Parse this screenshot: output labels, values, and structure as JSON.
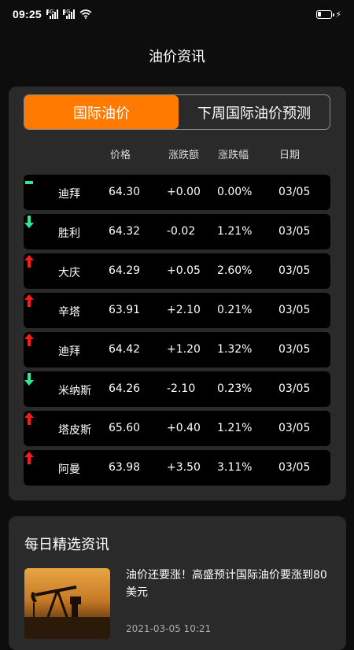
{
  "status_bar": {
    "time": "09:25",
    "signal_label_1": "4G",
    "signal_label_2": "4G",
    "signal_sub": "R"
  },
  "header": {
    "title": "油价资讯"
  },
  "tabs": [
    {
      "label": "国际油价",
      "active": true
    },
    {
      "label": "下周国际油价预测",
      "active": false
    }
  ],
  "columns": {
    "price": "价格",
    "change": "涨跌额",
    "pct": "涨跌幅",
    "date": "日期"
  },
  "rows": [
    {
      "name": "迪拜",
      "price": "64.30",
      "change": "+0.00",
      "pct": "0.00%",
      "date": "03/05",
      "trend": "flat"
    },
    {
      "name": "胜利",
      "price": "64.32",
      "change": "-0.02",
      "pct": "1.21%",
      "date": "03/05",
      "trend": "down"
    },
    {
      "name": "大庆",
      "price": "64.29",
      "change": "+0.05",
      "pct": "2.60%",
      "date": "03/05",
      "trend": "up"
    },
    {
      "name": "辛塔",
      "price": "63.91",
      "change": "+2.10",
      "pct": "0.21%",
      "date": "03/05",
      "trend": "up"
    },
    {
      "name": "迪拜",
      "price": "64.42",
      "change": "+1.20",
      "pct": "1.32%",
      "date": "03/05",
      "trend": "up"
    },
    {
      "name": "米纳斯",
      "price": "64.26",
      "change": "-2.10",
      "pct": "0.23%",
      "date": "03/05",
      "trend": "down"
    },
    {
      "name": "塔皮斯",
      "price": "65.60",
      "change": "+0.40",
      "pct": "1.21%",
      "date": "03/05",
      "trend": "up"
    },
    {
      "name": "阿曼",
      "price": "63.98",
      "change": "+3.50",
      "pct": "3.11%",
      "date": "03/05",
      "trend": "up"
    }
  ],
  "colors": {
    "accent": "#ff7a00",
    "up": "#ff1a1a",
    "down": "#2ee89a",
    "flat": "#2ee89a"
  },
  "news": {
    "section_title": "每日精选资讯",
    "items": [
      {
        "headline": "油价还要涨！高盛预计国际油价要涨到80美元",
        "time": "2021-03-05 10:21"
      }
    ]
  }
}
